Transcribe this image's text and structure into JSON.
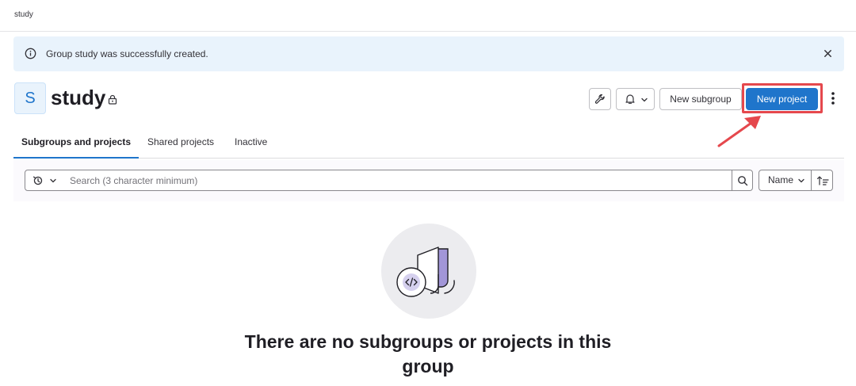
{
  "breadcrumb": {
    "text": "study"
  },
  "alert": {
    "message": "Group study was successfully created."
  },
  "group": {
    "avatar_letter": "S",
    "name": "study"
  },
  "actions": {
    "new_subgroup": "New subgroup",
    "new_project": "New project"
  },
  "tabs": [
    {
      "label": "Subgroups and projects",
      "active": true
    },
    {
      "label": "Shared projects",
      "active": false
    },
    {
      "label": "Inactive",
      "active": false
    }
  ],
  "filter": {
    "placeholder": "Search (3 character minimum)",
    "sort_value": "Name"
  },
  "empty_state": {
    "title": "There are no subgroups or projects in this group"
  },
  "colors": {
    "primary": "#1f75cb",
    "alert_bg": "#e9f3fc",
    "highlight": "#e5484d"
  },
  "icons": [
    "info-icon",
    "close-icon",
    "lock-icon",
    "wrench-icon",
    "bell-icon",
    "chevron-down-icon",
    "kebab-icon",
    "history-icon",
    "search-icon",
    "sort-direction-icon"
  ]
}
